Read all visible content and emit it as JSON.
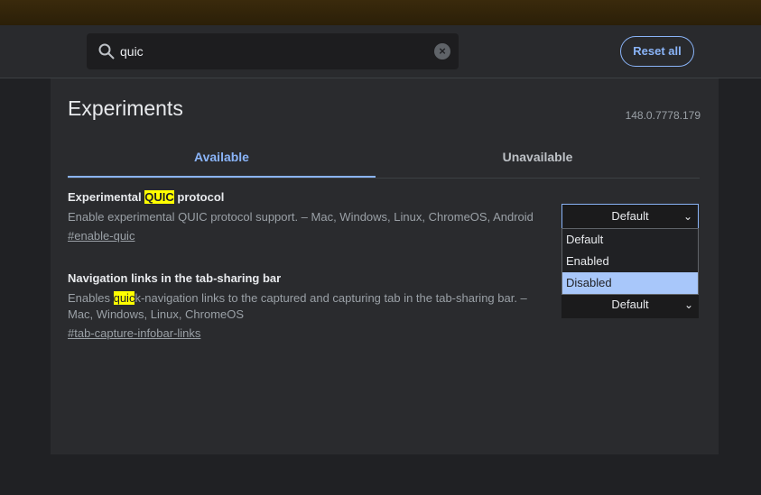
{
  "search": {
    "value": "quic"
  },
  "header": {
    "reset_label": "Reset all"
  },
  "page": {
    "title": "Experiments",
    "version": "148.0.7778.179"
  },
  "tabs": [
    {
      "label": "Available"
    },
    {
      "label": "Unavailable"
    }
  ],
  "experiments": [
    {
      "title_pre": "Experimental ",
      "title_match": "QUIC",
      "title_post": " protocol",
      "description": "Enable experimental QUIC protocol support. – Mac, Windows, Linux, ChromeOS, Android",
      "link": "#enable-quic",
      "select_value": "Default"
    },
    {
      "title": "Navigation links in the tab-sharing bar",
      "desc_pre": "Enables ",
      "desc_match": "quic",
      "desc_post": "k-navigation links to the captured and capturing tab in the tab-sharing bar. – Mac, Windows, Linux, ChromeOS",
      "link": "#tab-capture-infobar-links",
      "select_value": "Default"
    }
  ],
  "dropdown": {
    "options": [
      "Default",
      "Enabled",
      "Disabled"
    ],
    "highlighted": "Disabled"
  },
  "colors": {
    "accent": "#8ab4f8",
    "highlight": "#ffff00",
    "option_hover": "#a8c7fa"
  }
}
